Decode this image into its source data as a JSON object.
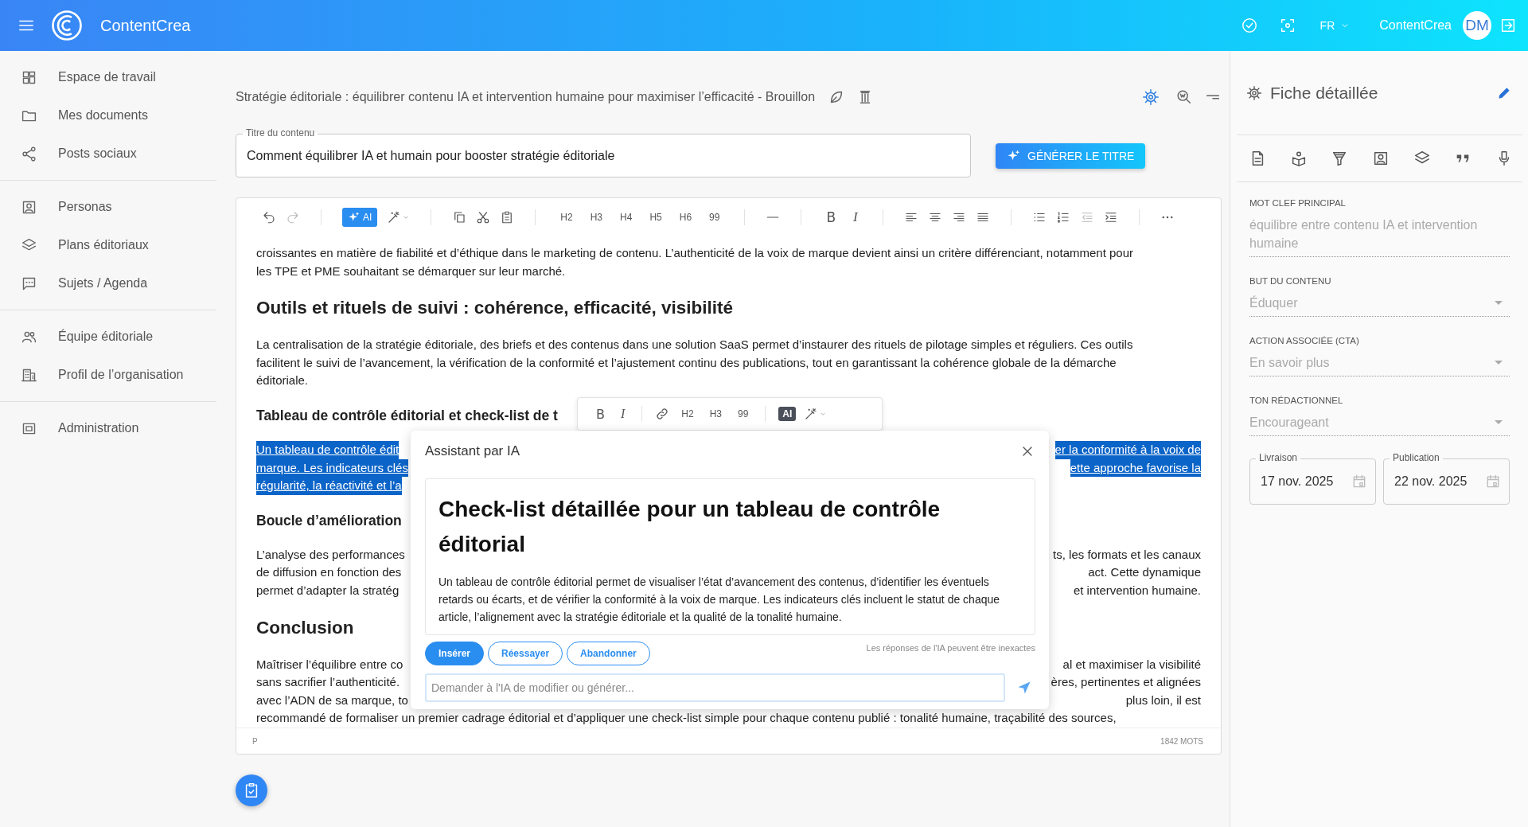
{
  "top_bar": {
    "app_name": "ContentCrea",
    "language": "FR",
    "account_name": "ContentCrea",
    "avatar_initials": "DM"
  },
  "sidebar": {
    "groups": [
      {
        "items": [
          {
            "label": "Espace de travail"
          },
          {
            "label": "Mes documents"
          },
          {
            "label": "Posts sociaux"
          }
        ]
      },
      {
        "items": [
          {
            "label": "Personas"
          },
          {
            "label": "Plans éditoriaux"
          },
          {
            "label": "Sujets / Agenda"
          }
        ]
      },
      {
        "items": [
          {
            "label": "Équipe éditoriale"
          },
          {
            "label": "Profil de l’organisation"
          }
        ]
      },
      {
        "items": [
          {
            "label": "Administration"
          }
        ]
      }
    ]
  },
  "document": {
    "heading": "Stratégie éditoriale : équilibrer contenu IA et intervention humaine pour maximiser l’efficacité - Brouillon"
  },
  "title_field": {
    "label": "Titre du contenu",
    "value": "Comment équilibrer IA et humain pour booster stratégie éditoriale"
  },
  "generate_button": "GÉNÉRER LE TITRE",
  "toolbar": {
    "ai_label": "AI",
    "headings": [
      "H2",
      "H3",
      "H4",
      "H5",
      "H6",
      "99"
    ],
    "bold": "B",
    "italic": "I"
  },
  "bubble_toolbar": {
    "bold": "B",
    "italic": "I",
    "headings": [
      "H2",
      "H3",
      "99"
    ],
    "ai_label": "AI"
  },
  "blocks": [
    {
      "kind": "p",
      "selected": false,
      "lines": [
        [
          "croissantes en matière de fiabilité et d’éthique dans le marketing de contenu. L’authenticité de la voix de marque devient ainsi un critère différenciant, notamment pour"
        ],
        [
          "les TPE et PME souhaitant se démarquer sur leur marché."
        ]
      ]
    },
    {
      "kind": "h2",
      "selected": false,
      "lines": [
        [
          "Outils et rituels de suivi : cohérence, efficacité, visibilité"
        ]
      ]
    },
    {
      "kind": "p",
      "selected": false,
      "lines": [
        [
          "La centralisation de la stratégie éditoriale, des briefs et des contenus dans une solution SaaS permet d’instaurer des rituels de pilotage simples et réguliers. Ces outils"
        ],
        [
          "facilitent le suivi de l’avancement, la vérification de la conformité et l’ajustement continu des publications, tout en garantissant la cohérence globale de la démarche"
        ],
        [
          "éditoriale."
        ]
      ]
    },
    {
      "kind": "h3",
      "selected": false,
      "lines": [
        [
          "Tableau de contrôle éditorial et check-list de t"
        ]
      ]
    },
    {
      "kind": "p",
      "selected": true,
      "lines": [
        [
          "Un tableau de contrôle édit",
          "er la conformité à la voix de"
        ],
        [
          "marque. Les indicateurs clés",
          "ette approche favorise la"
        ],
        [
          "régularité, la réactivité et l’a"
        ]
      ]
    },
    {
      "kind": "h3",
      "selected": false,
      "lines": [
        [
          "Boucle d’amélioration"
        ]
      ]
    },
    {
      "kind": "p",
      "selected": false,
      "lines": [
        [
          "L’analyse des performances",
          "ts, les formats et les canaux"
        ],
        [
          "de diffusion en fonction des",
          "act. Cette dynamique"
        ],
        [
          "permet d’adapter la stratég",
          "et intervention humaine."
        ]
      ]
    },
    {
      "kind": "h2",
      "selected": false,
      "lines": [
        [
          "Conclusion"
        ]
      ]
    },
    {
      "kind": "p",
      "selected": false,
      "lines": [
        [
          "Maîtriser l’équilibre entre co",
          "al et maximiser la visibilité"
        ],
        [
          "sans sacrifier l’authenticité.",
          "ères, pertinentes et alignées"
        ],
        [
          "avec l’ADN de sa marque, to",
          "plus loin, il est"
        ],
        [
          "recommandé de formaliser un premier cadrage éditorial et d’appliquer une check-list simple pour chaque contenu publié : tonalité humaine, traçabilité des sources,"
        ]
      ]
    }
  ],
  "status_bar": {
    "node": "P",
    "word_count": "1842 MOTS"
  },
  "ai_assistant": {
    "title": "Assistant par IA",
    "heading": "Check-list détaillée pour un tableau de contrôle éditorial",
    "body": "Un tableau de contrôle éditorial permet de visualiser l’état d’avancement des contenus, d’identifier les éventuels retards ou écarts, et de vérifier la conformité à la voix de marque. Les indicateurs clés incluent le statut de chaque article, l’alignement avec la stratégie éditoriale et la qualité de la tonalité humaine.",
    "buttons": [
      {
        "label": "Insérer",
        "primary": true
      },
      {
        "label": "Réessayer",
        "primary": false
      },
      {
        "label": "Abandonner",
        "primary": false
      }
    ],
    "disclaimer": "Les réponses de l'IA peuvent être inexactes",
    "prompt": {
      "placeholder": "Demander à l'IA de modifier ou générer..."
    }
  },
  "detail_panel": {
    "title": "Fiche détaillée",
    "fields": [
      {
        "kind": "text",
        "label": "MOT CLEF PRINCIPAL",
        "value": "équilibre entre contenu IA et intervention humaine",
        "disabled": true
      },
      {
        "kind": "select",
        "label": "BUT DU CONTENU",
        "value": "Éduquer",
        "disabled": true
      },
      {
        "kind": "select",
        "label": "ACTION ASSOCIÉE (CTA)",
        "value": "En savoir plus",
        "disabled": true
      },
      {
        "kind": "select",
        "label": "TON RÉDACTIONNEL",
        "value": "Encourageant",
        "disabled": true
      }
    ],
    "dates": [
      {
        "label": "Livraison",
        "value": "17 nov. 2025"
      },
      {
        "label": "Publication",
        "value": "22 nov. 2025"
      }
    ]
  }
}
